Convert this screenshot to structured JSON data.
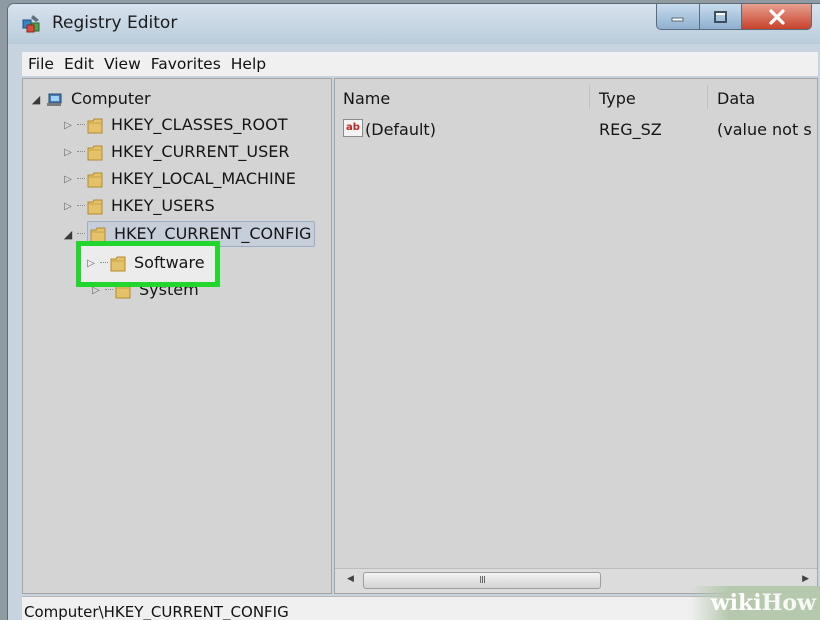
{
  "window": {
    "title": "Registry Editor",
    "icon": "registry-editor-icon",
    "controls": [
      "minimize-icon",
      "maximize-icon",
      "close-icon"
    ]
  },
  "menu": [
    "File",
    "Edit",
    "View",
    "Favorites",
    "Help"
  ],
  "tree": {
    "root": "Computer",
    "hives": [
      "HKEY_CLASSES_ROOT",
      "HKEY_CURRENT_USER",
      "HKEY_LOCAL_MACHINE",
      "HKEY_USERS"
    ],
    "expanded_hive": "HKEY_CURRENT_CONFIG",
    "children": [
      "Software",
      "System"
    ],
    "highlighted_child": "Software"
  },
  "list": {
    "columns": [
      "Name",
      "Type",
      "Data"
    ],
    "rows": [
      {
        "name": "(Default)",
        "type": "REG_SZ",
        "data": "(value not s"
      }
    ],
    "value_icon": "string-value-icon",
    "scroll_grip": "III"
  },
  "status": "Computer\\HKEY_CURRENT_CONFIG",
  "watermark": {
    "left": "wiki",
    "right": "How"
  },
  "colors": {
    "highlight_box": "#22d62d",
    "close_button": "#c8422c",
    "selection_border": "#9aaec6"
  }
}
